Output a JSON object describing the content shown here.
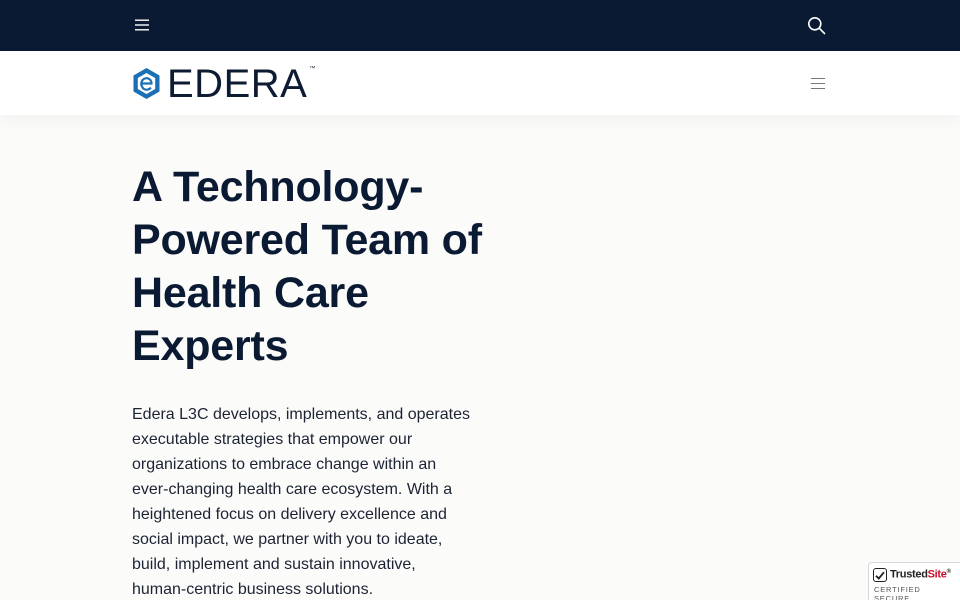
{
  "topbar": {
    "menu_icon": "hamburger-icon",
    "search_icon": "search-icon",
    "background": "#0b1a33"
  },
  "header": {
    "logo": {
      "text": "EDERA",
      "trademark": "™",
      "icon": "edera-logo-mark",
      "accent": "#1a6fb5"
    },
    "menu_icon": "hamburger-icon"
  },
  "hero": {
    "title": "A Technology-Powered Team of Health Care Experts",
    "body": "Edera L3C develops, implements, and operates executable strategies that empower our organizations to embrace change within an ever-changing health care ecosystem. With a heightened focus on delivery excellence and social impact, we partner with you to ideate, build, implement and sustain innovative, human-centric business solutions."
  },
  "trust_badge": {
    "brand_main": "Trusted",
    "brand_accent": "Site",
    "trademark": "®",
    "caption": "CERTIFIED SECURE"
  }
}
